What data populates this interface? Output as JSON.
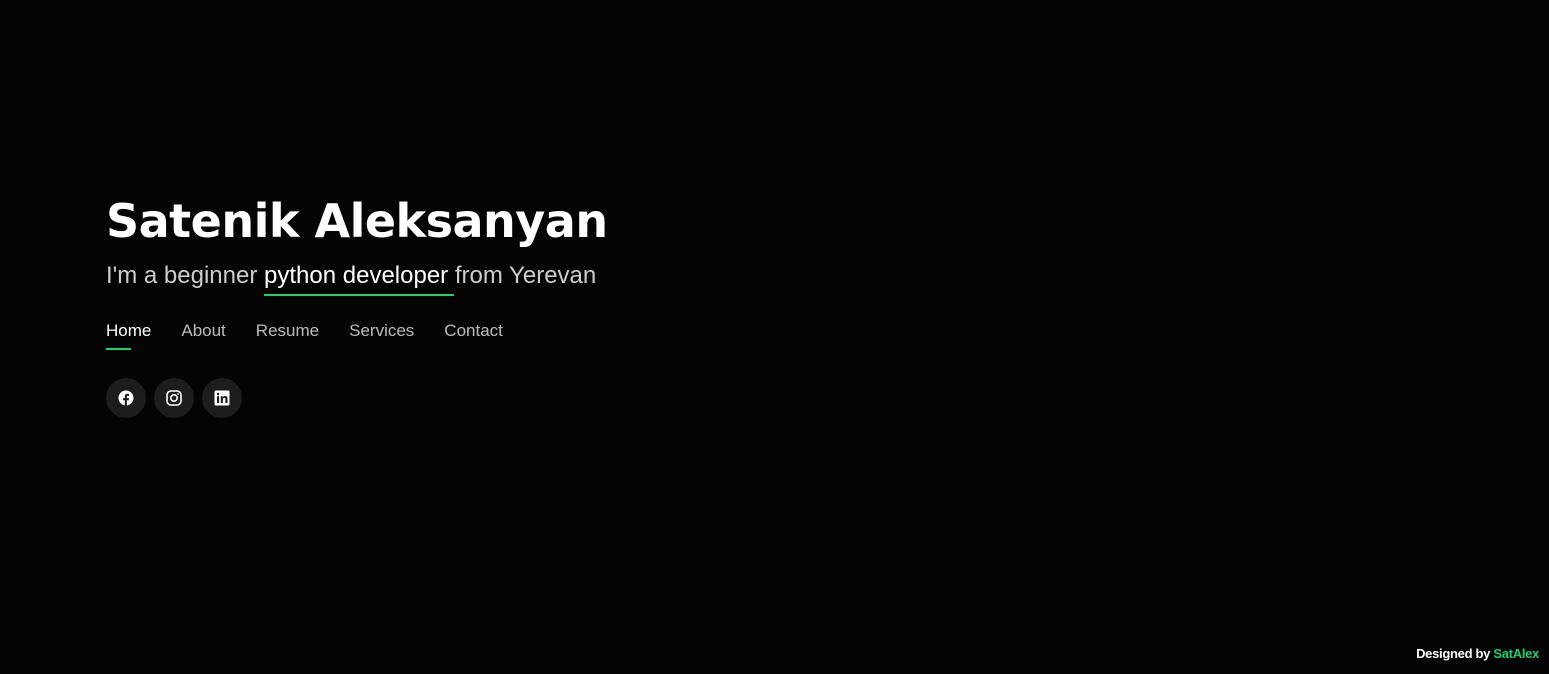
{
  "hero": {
    "name": "Satenik Aleksanyan",
    "tagline_before": "I'm a beginner ",
    "tagline_highlight": "python developer",
    "tagline_after": " from Yerevan"
  },
  "nav": {
    "items": [
      {
        "label": "Home",
        "active": true
      },
      {
        "label": "About",
        "active": false
      },
      {
        "label": "Resume",
        "active": false
      },
      {
        "label": "Services",
        "active": false
      },
      {
        "label": "Contact",
        "active": false
      }
    ]
  },
  "social": {
    "links": [
      {
        "icon": "facebook-icon"
      },
      {
        "icon": "instagram-icon"
      },
      {
        "icon": "linkedin-icon"
      }
    ]
  },
  "credits": {
    "prefix": "Designed by ",
    "author": "SatAlex"
  },
  "colors": {
    "background": "#040404",
    "accent": "#18d26e",
    "social_bg": "#1d1d1d"
  }
}
